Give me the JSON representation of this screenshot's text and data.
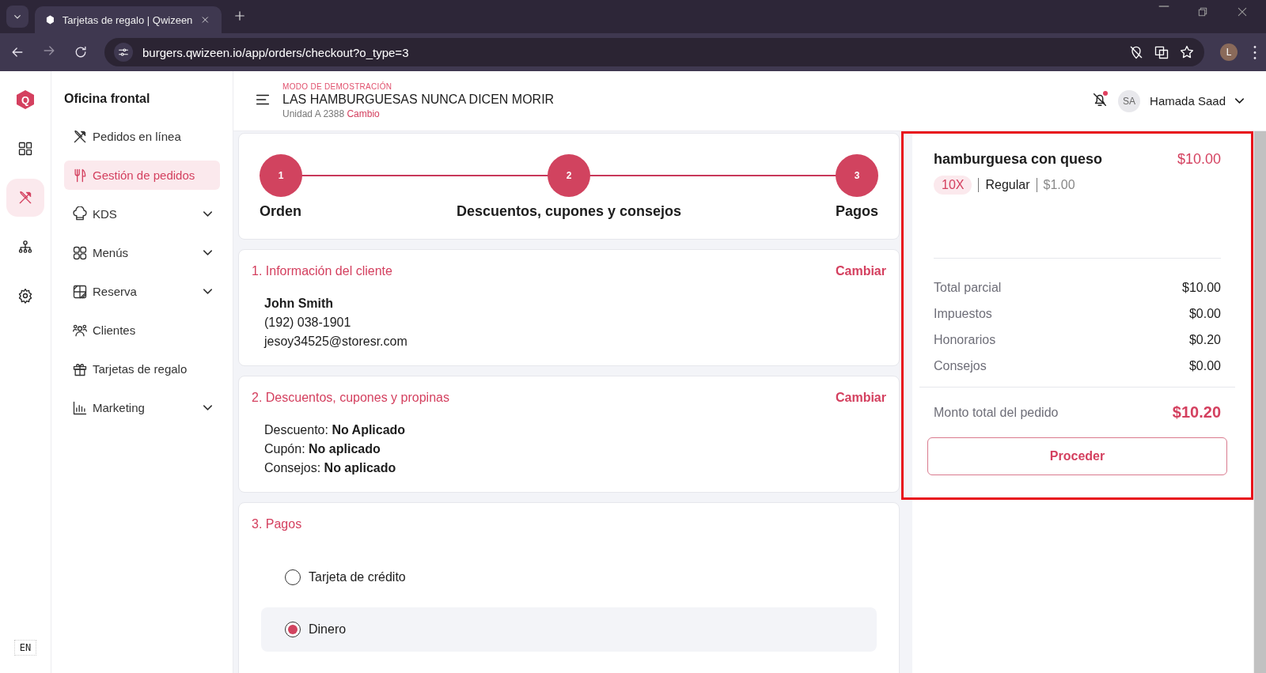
{
  "browser": {
    "tabs": [
      {
        "title": "Tarjetas de regalo | Qwizeen",
        "selected": true
      }
    ],
    "url": "burgers.qwizeen.io/app/orders/checkout?o_type=3",
    "profile_initial": "L"
  },
  "rail": {
    "logo": "Q",
    "items": [
      {
        "kind": "dashboard",
        "selected": false
      },
      {
        "kind": "utensils",
        "selected": true
      },
      {
        "kind": "hierarchy",
        "selected": false
      },
      {
        "kind": "settings",
        "selected": false
      }
    ],
    "language": "EN"
  },
  "sidebar": {
    "title": "Oficina frontal",
    "items": [
      {
        "label": "Pedidos en línea",
        "kind": "utensils",
        "selected": false,
        "expandable": false
      },
      {
        "label": "Gestión de pedidos",
        "kind": "fork-knife",
        "selected": true,
        "expandable": false
      },
      {
        "label": "KDS",
        "kind": "chef-hat",
        "selected": false,
        "expandable": true
      },
      {
        "label": "Menús",
        "kind": "grid",
        "selected": false,
        "expandable": true
      },
      {
        "label": "Reserva",
        "kind": "table",
        "selected": false,
        "expandable": true
      },
      {
        "label": "Clientes",
        "kind": "people",
        "selected": false,
        "expandable": false
      },
      {
        "label": "Tarjetas de regalo",
        "kind": "gift",
        "selected": false,
        "expandable": false
      },
      {
        "label": "Marketing",
        "kind": "chart",
        "selected": false,
        "expandable": true
      }
    ]
  },
  "header": {
    "demo_label": "MODO DE DEMOSTRACIÓN",
    "store_name": "LAS HAMBURGUESAS NUNCA DICEN MORIR",
    "unit": "Unidad A 2388",
    "change_link": "Cambio",
    "user": {
      "initials": "SA",
      "name": "Hamada Saad"
    }
  },
  "stepper": {
    "steps": [
      {
        "number": "1",
        "label": "Orden"
      },
      {
        "number": "2",
        "label": "Descuentos, cupones y consejos"
      },
      {
        "number": "3",
        "label": "Pagos"
      }
    ]
  },
  "customer": {
    "title": "1. Información del cliente",
    "action": "Cambiar",
    "name": "John Smith",
    "phone": "(192) 038-1901",
    "email": "jesoy34525@storesr.com"
  },
  "discounts": {
    "title": "2. Descuentos, cupones y propinas",
    "action": "Cambiar",
    "lines": [
      "Descuento: **No Aplicado**",
      "Cupón: **No aplicado**",
      "Consejos: **No aplicado**"
    ]
  },
  "payments": {
    "title": "3. Pagos",
    "options": [
      {
        "label": "Tarjeta de crédito",
        "selected": false
      },
      {
        "label": "Dinero",
        "selected": true
      }
    ]
  },
  "summary": {
    "highlighted": true,
    "item": {
      "name": "hamburguesa con queso",
      "price": "$10.00",
      "quantity": "10X",
      "variant": "Regular",
      "unit_price": "$1.00"
    },
    "rows": [
      {
        "label": "Total parcial",
        "value": "$10.00"
      },
      {
        "label": "Impuestos",
        "value": "$0.00"
      },
      {
        "label": "Honorarios",
        "value": "$0.20"
      },
      {
        "label": "Consejos",
        "value": "$0.00"
      }
    ],
    "total_label": "Monto total del pedido",
    "total_value": "$10.20",
    "button": "Proceder"
  }
}
